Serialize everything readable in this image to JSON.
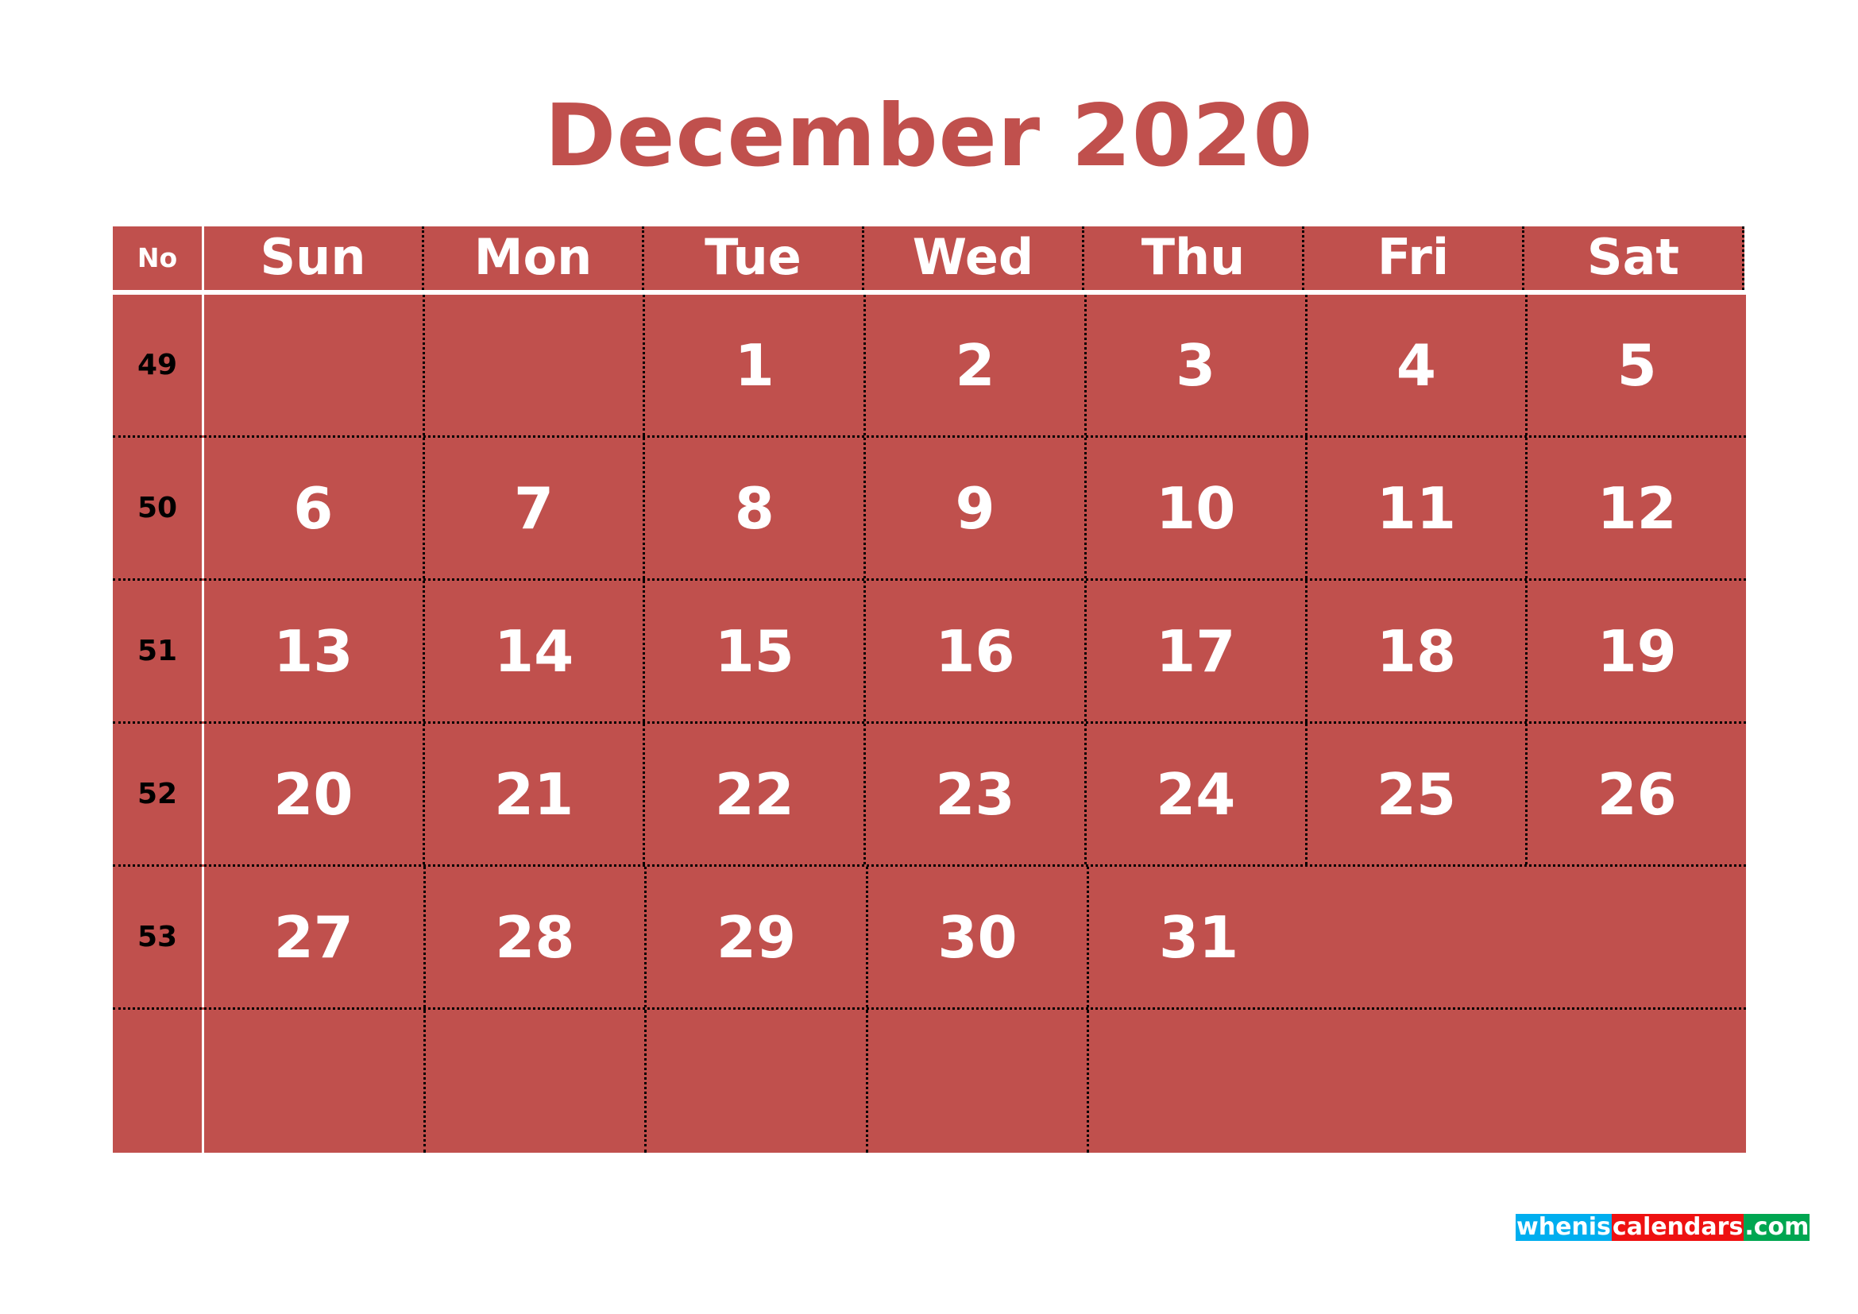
{
  "title": "December 2020",
  "theme": {
    "accent": "#C0504D",
    "title_color": "#C0504D",
    "day_text": "#ffffff",
    "week_no_text": "#000000",
    "page_bg": "#ffffff",
    "grid_line": "#000000",
    "no_column_line": "#ffffff"
  },
  "header": {
    "week_no_label": "No",
    "days": [
      "Sun",
      "Mon",
      "Tue",
      "Wed",
      "Thu",
      "Fri",
      "Sat"
    ]
  },
  "weeks": [
    {
      "no": "49",
      "days": [
        "",
        "",
        "1",
        "2",
        "3",
        "4",
        "5"
      ]
    },
    {
      "no": "50",
      "days": [
        "6",
        "7",
        "8",
        "9",
        "10",
        "11",
        "12"
      ]
    },
    {
      "no": "51",
      "days": [
        "13",
        "14",
        "15",
        "16",
        "17",
        "18",
        "19"
      ]
    },
    {
      "no": "52",
      "days": [
        "20",
        "21",
        "22",
        "23",
        "24",
        "25",
        "26"
      ]
    },
    {
      "no": "53",
      "days": [
        "27",
        "28",
        "29",
        "30",
        "31",
        "",
        ""
      ]
    },
    {
      "no": "",
      "days": [
        "",
        "",
        "",
        "",
        "",
        "",
        ""
      ]
    }
  ],
  "watermark": {
    "part1": "whenis",
    "part2": "calendars",
    "part3": ".com",
    "color1": "#00AEEF",
    "color2": "#EE1111",
    "color3": "#00A651"
  }
}
